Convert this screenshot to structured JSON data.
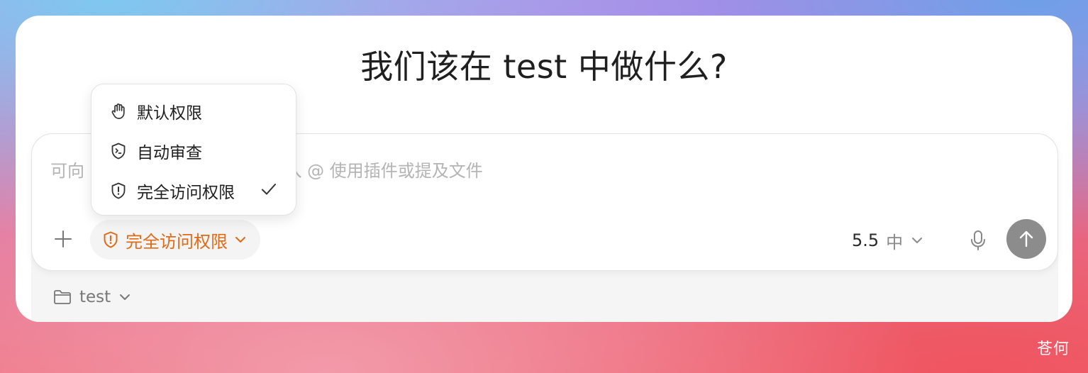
{
  "heading": "我们该在 test 中做什么?",
  "composer": {
    "placeholder_visible": "可向 Codex 提出任何要求，输入 @ 使用插件或提及文件",
    "permission_chip": {
      "label": "完全访问权限",
      "icon": "shield-alert-icon",
      "color": "#e06a15"
    },
    "model": {
      "version": "5.5",
      "level": "中"
    },
    "add_icon": "plus-icon",
    "mic_icon": "microphone-icon",
    "send_icon": "arrow-up-icon"
  },
  "permission_menu": {
    "items": [
      {
        "label": "默认权限",
        "icon": "hand-icon",
        "selected": false
      },
      {
        "label": "自动审查",
        "icon": "shield-terminal-icon",
        "selected": false
      },
      {
        "label": "完全访问权限",
        "icon": "shield-alert-icon",
        "selected": true
      }
    ]
  },
  "footer": {
    "folder_icon": "folder-icon",
    "project": "test"
  },
  "watermark": "苍何",
  "colors": {
    "accent": "#e06a15",
    "send_button": "#8c8c8c",
    "chip_bg": "#f4f4f4"
  }
}
